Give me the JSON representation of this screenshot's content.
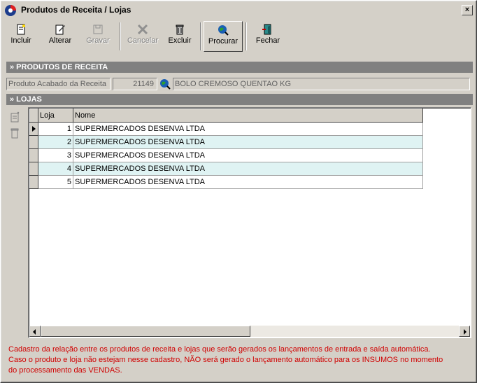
{
  "window": {
    "title": "Produtos de Receita / Lojas",
    "close_label": "×"
  },
  "toolbar": {
    "incluir": "Incluir",
    "alterar": "Alterar",
    "gravar": "Gravar",
    "cancelar": "Cancelar",
    "excluir": "Excluir",
    "procurar": "Procurar",
    "fechar": "Fechar"
  },
  "sections": {
    "produtos": "» PRODUTOS DE RECEITA",
    "lojas": "» LOJAS"
  },
  "produto": {
    "label": "Produto Acabado da Receita",
    "code": "21149",
    "description": "BOLO CREMOSO QUENTAO KG"
  },
  "grid": {
    "columns": [
      "Loja",
      "Nome"
    ],
    "rows": [
      {
        "loja": "1",
        "nome": "SUPERMERCADOS DESENVA LTDA"
      },
      {
        "loja": "2",
        "nome": "SUPERMERCADOS DESENVA LTDA"
      },
      {
        "loja": "3",
        "nome": "SUPERMERCADOS DESENVA LTDA"
      },
      {
        "loja": "4",
        "nome": "SUPERMERCADOS DESENVA LTDA"
      },
      {
        "loja": "5",
        "nome": "SUPERMERCADOS DESENVA LTDA"
      }
    ]
  },
  "footer": {
    "line1": "Cadastro da relação entre os produtos de receita e lojas que serão gerados os lançamentos de entrada e saída automática.",
    "line2": "Caso o produto e loja não estejam nesse cadastro, NÃO será gerado o lançamento automático para os INSUMOS no momento",
    "line3": "do processamento das VENDAS."
  },
  "colors": {
    "footer_text": "#d00000",
    "alt_row": "#dff3f3",
    "section_bar": "#808080"
  },
  "icons": [
    "app-icon",
    "incluir-icon",
    "alterar-icon",
    "gravar-icon",
    "cancelar-icon",
    "excluir-icon",
    "procurar-icon",
    "fechar-icon",
    "lookup-globe-icon",
    "add-row-icon",
    "delete-row-icon"
  ]
}
